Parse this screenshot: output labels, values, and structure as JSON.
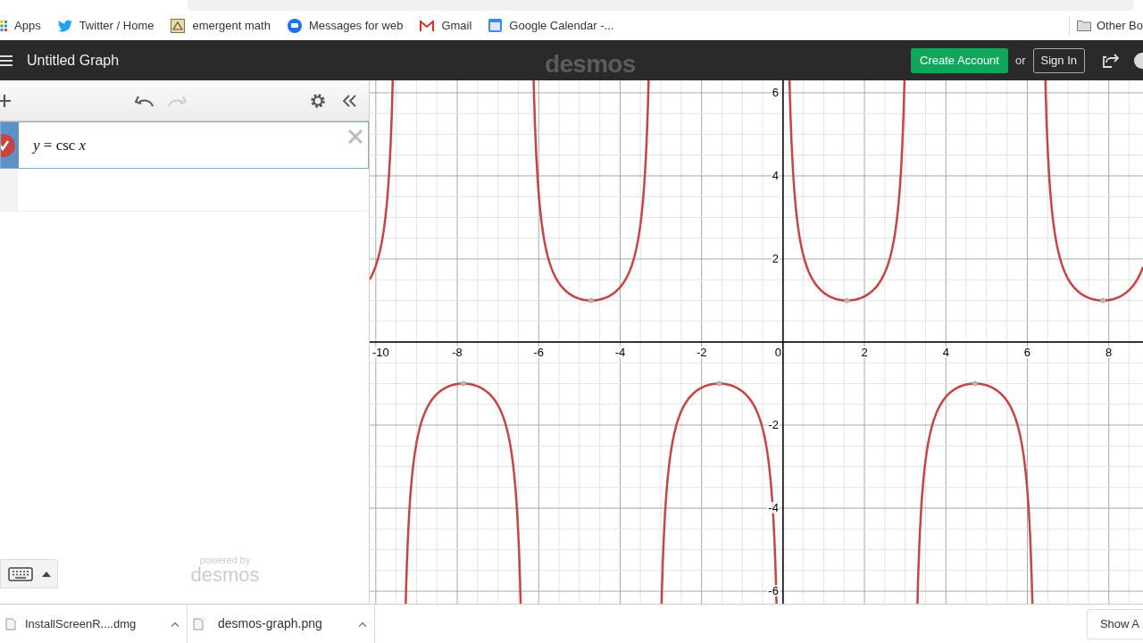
{
  "bookmarks": [
    {
      "label": "Apps",
      "kind": "apps"
    },
    {
      "label": "Twitter / Home",
      "kind": "bird"
    },
    {
      "label": "emergent math",
      "kind": "frame"
    },
    {
      "label": "Messages for web",
      "kind": "chat"
    },
    {
      "label": "Gmail",
      "kind": "mail"
    },
    {
      "label": "Google Calendar -...",
      "kind": "calendar"
    }
  ],
  "other_bookmarks": "Other Bo",
  "header": {
    "title": "Untitled Graph",
    "logo": "desmos",
    "create_account": "Create Account",
    "or": "or",
    "sign_in": "Sign In"
  },
  "expressions": [
    {
      "latex": "*y* = csc *x*",
      "color": "#c74440",
      "visible": true,
      "selected": true,
      "kind": "csc"
    }
  ],
  "powered_by": "powered by",
  "powered_logo": "desmos",
  "graph": {
    "xticks": [
      "-10",
      "-8",
      "-6",
      "-4",
      "-2",
      "0",
      "2",
      "4",
      "6",
      "8"
    ],
    "yticks": [
      "6",
      "4",
      "2",
      "-2",
      "-4",
      "-6"
    ]
  },
  "downloads": [
    {
      "name": "InstallScreenR....dmg"
    },
    {
      "name": "desmos-graph.png"
    }
  ],
  "show_all": "Show A"
}
